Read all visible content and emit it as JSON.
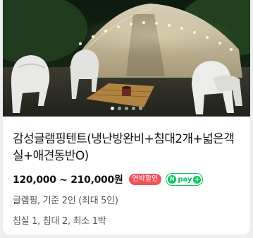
{
  "listing": {
    "title": "감성글램핑텐트(냉난방완비+침대2개+넓은객실+애견동반O)",
    "price": "120,000 ~ 210,000원",
    "discount_badge": "연박할인",
    "pay_badge": {
      "logo_letter": "N",
      "text": "pay",
      "plus": "+"
    },
    "type_capacity": "글램핑, 기준 2인 (최대 5인)",
    "room_info": "침실 1, 침대 2, 최소 1박"
  },
  "carousel": {
    "slides": 5,
    "active_index": 0
  },
  "colors": {
    "badge": "#f0525c",
    "npay": "#03c75a"
  }
}
